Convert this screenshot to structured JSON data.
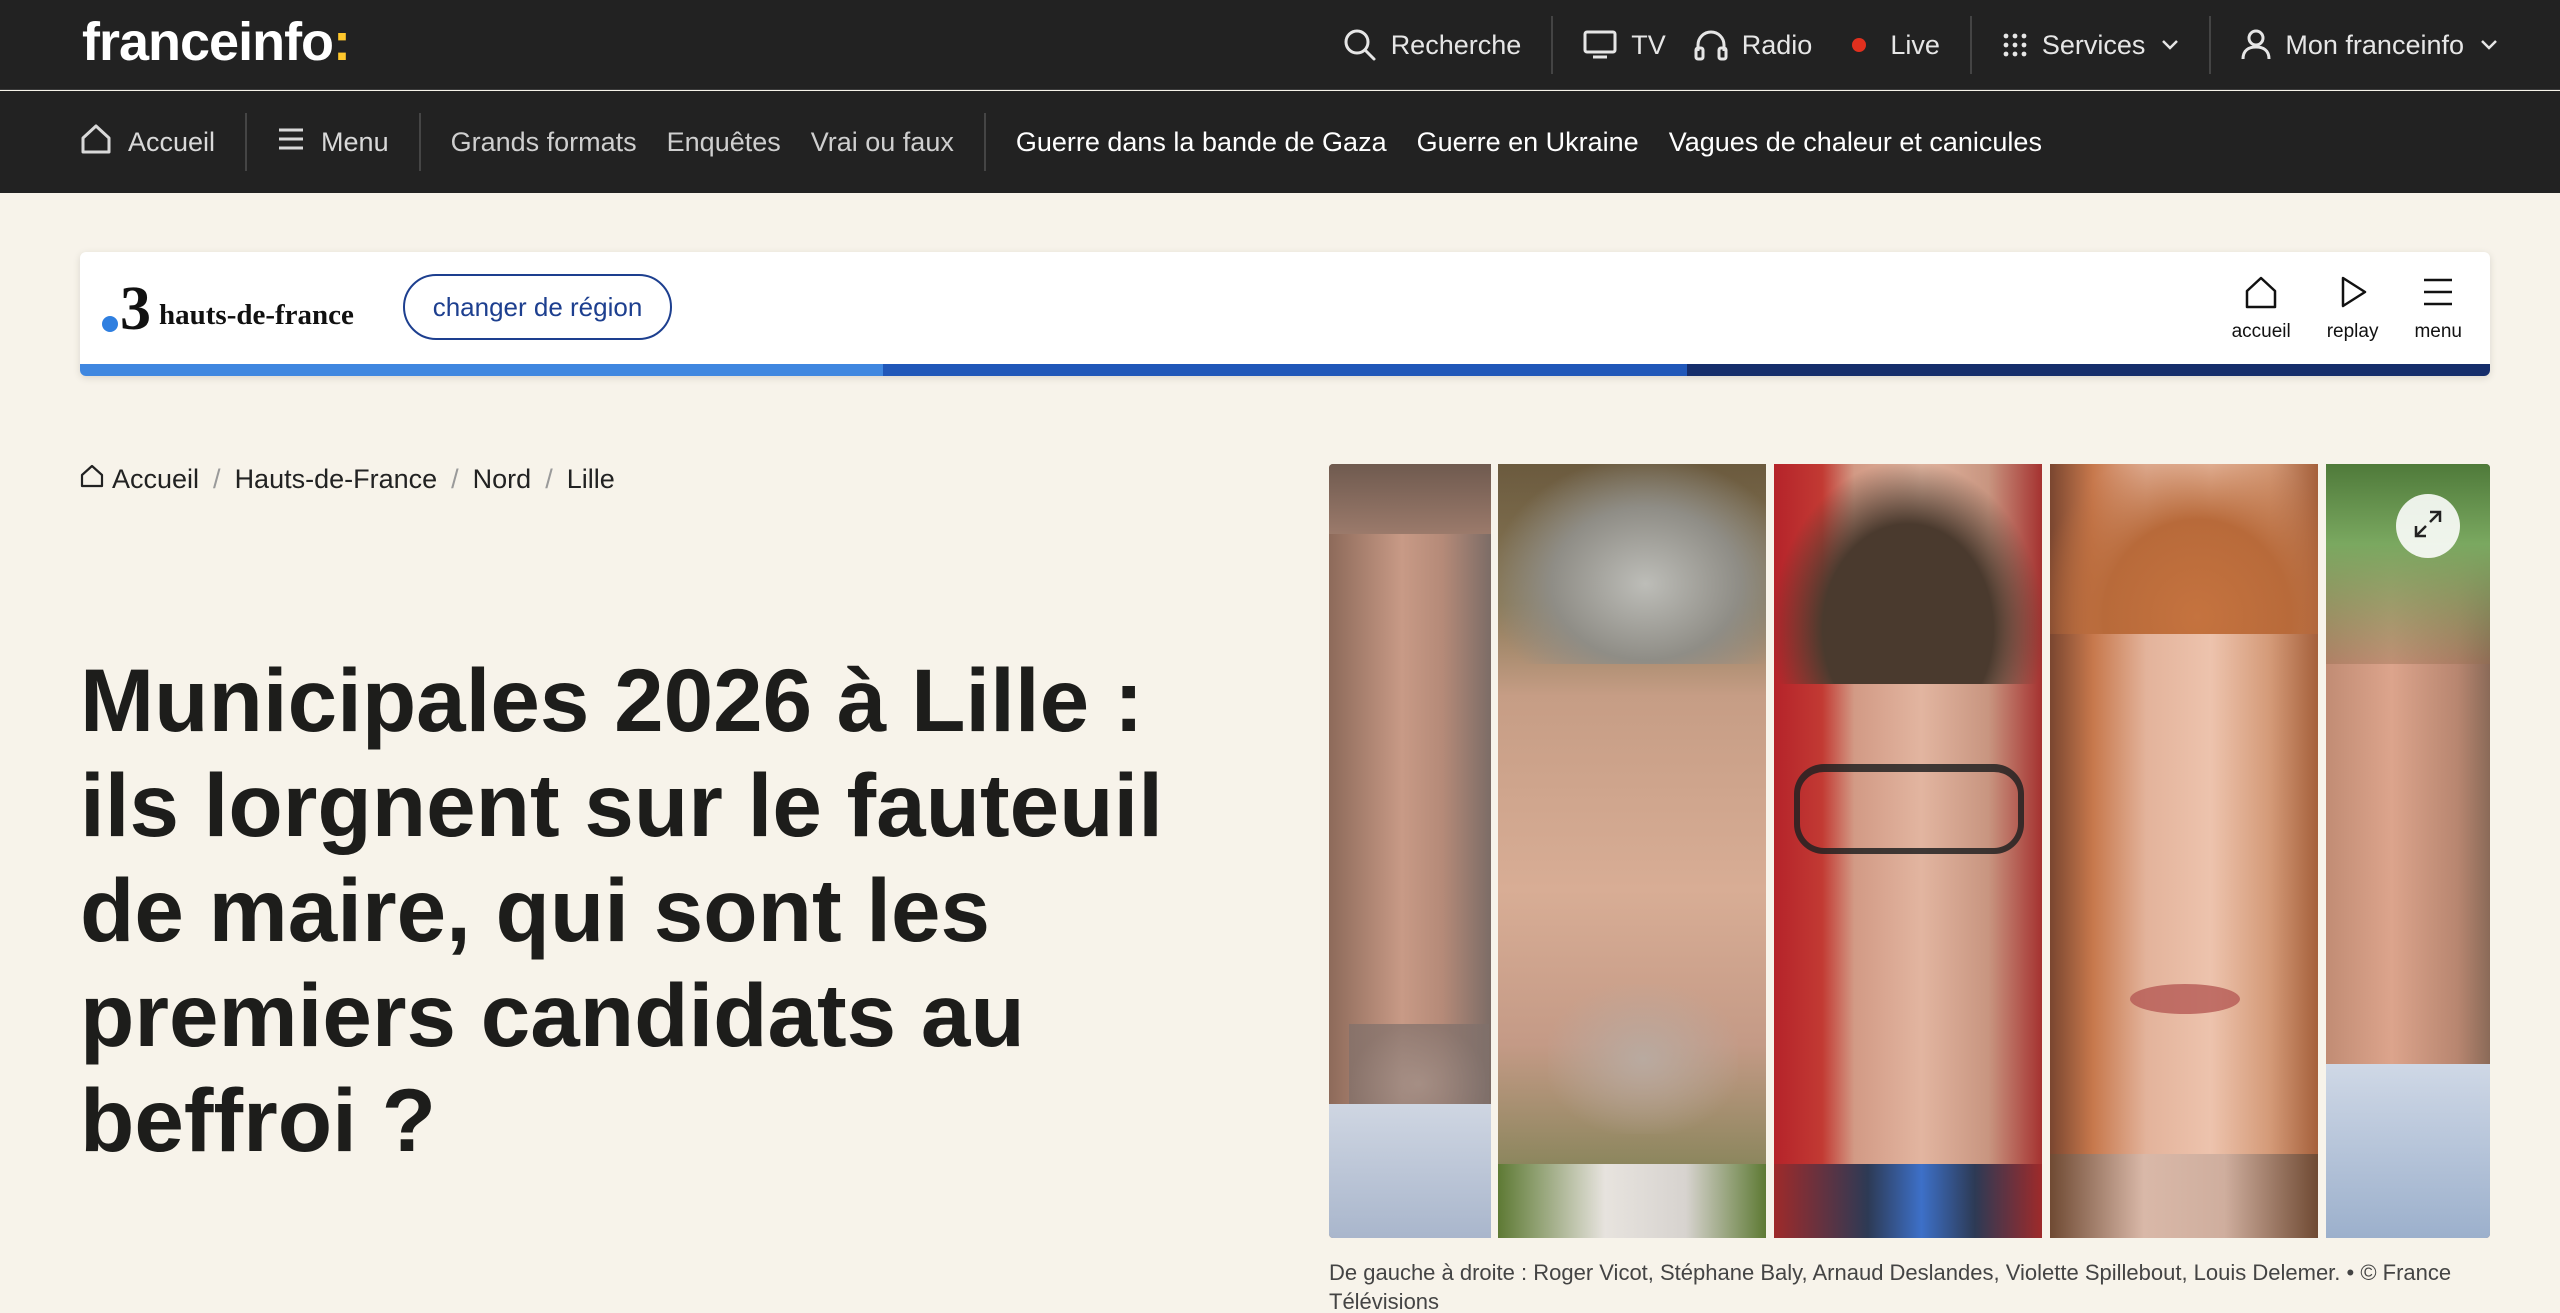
{
  "topbar": {
    "logo_text": "franceinfo",
    "logo_colon": ":",
    "search_label": "Recherche",
    "tv_label": "TV",
    "radio_label": "Radio",
    "live_label": "Live",
    "services_label": "Services",
    "account_label": "Mon franceinfo"
  },
  "nav": {
    "home_label": "Accueil",
    "menu_label": "Menu",
    "links": [
      "Grands formats",
      "Enquêtes",
      "Vrai ou faux"
    ],
    "hot_links": [
      "Guerre dans la bande de Gaza",
      "Guerre en Ukraine",
      "Vagues de chaleur et canicules"
    ]
  },
  "region": {
    "logo_number": "3",
    "logo_name": "hauts-de-france",
    "change_label": "changer de région",
    "actions": [
      "accueil",
      "replay",
      "menu"
    ],
    "stripe_colors": [
      "#3f87e0",
      "#2057b9",
      "#152d6b"
    ]
  },
  "breadcrumb": [
    "Accueil",
    "Hauts-de-France",
    "Nord",
    "Lille"
  ],
  "article": {
    "headline": "Municipales 2026 à Lille : ils lorgnent sur le fauteuil de maire, qui sont les premiers candidats au beffroi ?",
    "caption": "De gauche à droite : Roger Vicot, Stéphane Baly, Arnaud Deslandes, Violette Spillebout, Louis Delemer. • © France Télévisions"
  },
  "colors": {
    "bar_bg": "#222222",
    "page_bg": "#f7f3ea",
    "accent_yellow": "#ffc72c",
    "live_red": "#e1301e",
    "region_blue": "#1d3f8f"
  }
}
